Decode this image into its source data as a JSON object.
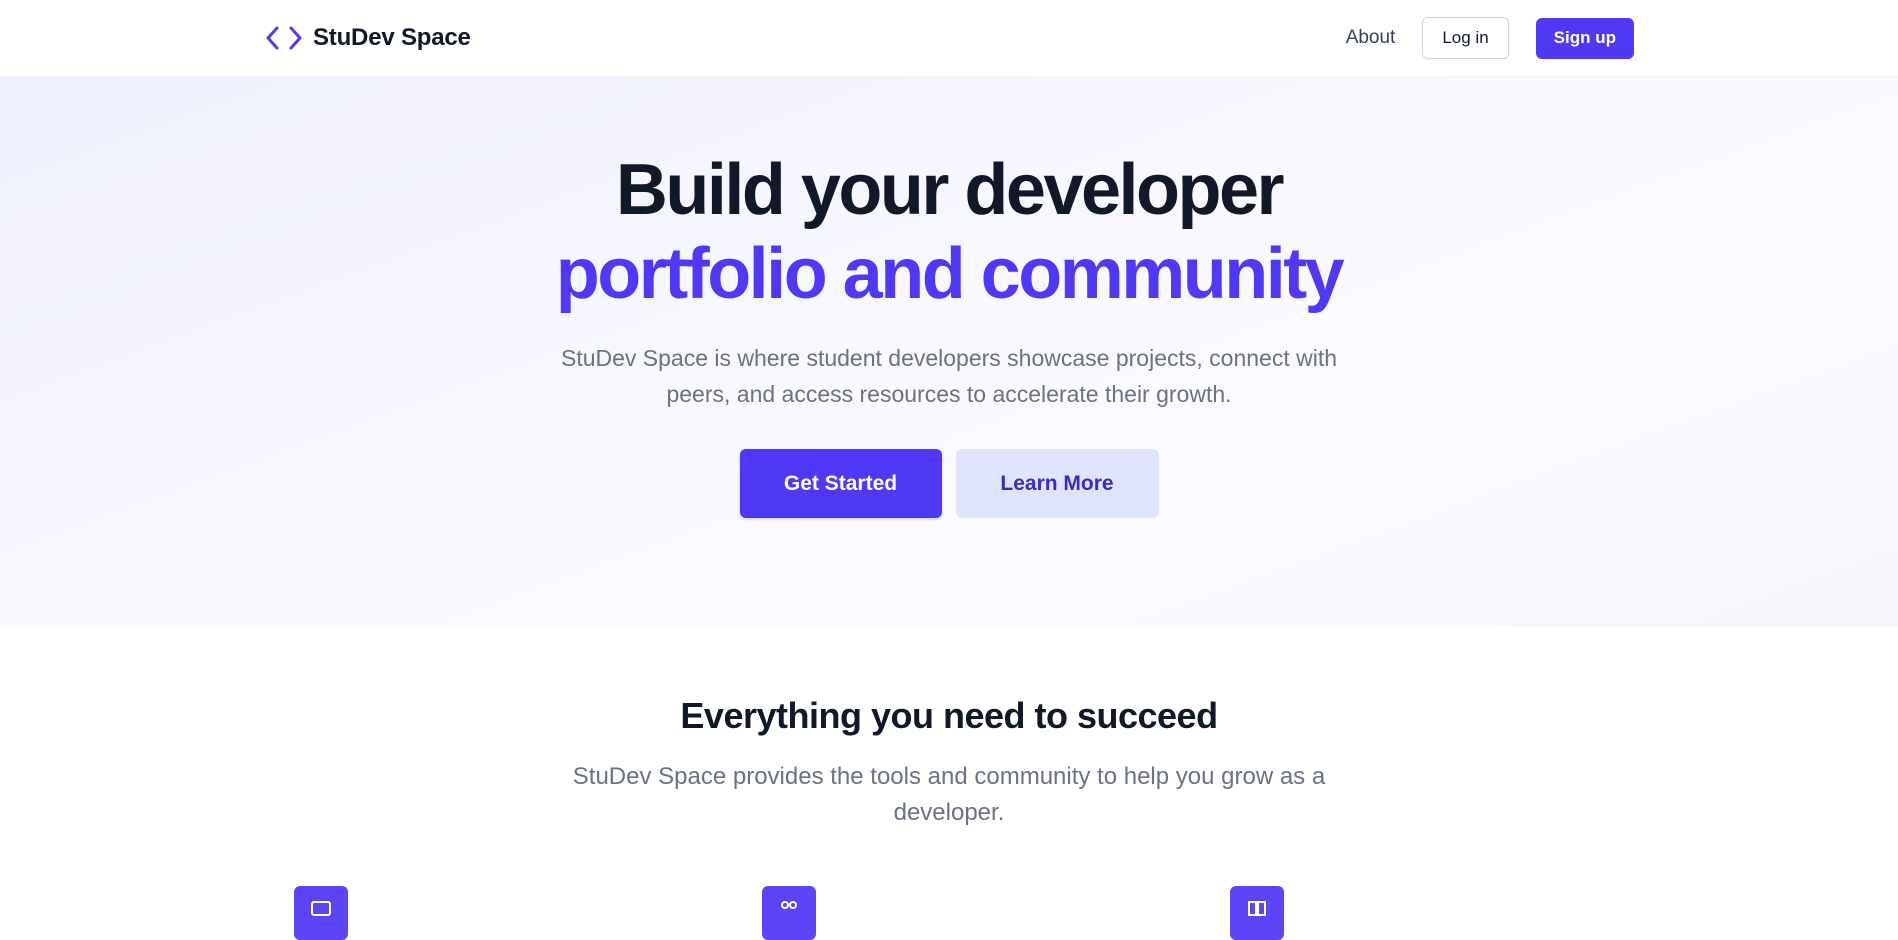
{
  "nav": {
    "brand_name": "StuDev Space",
    "brand_icon": "code-brackets-icon",
    "about_label": "About",
    "login_label": "Log in",
    "signup_label": "Sign up"
  },
  "hero": {
    "title_line1": "Build your developer",
    "title_line2": "portfolio and community",
    "subtitle": "StuDev Space is where student developers showcase projects, connect with peers, and access resources to accelerate their growth.",
    "primary_cta": "Get Started",
    "secondary_cta": "Learn More"
  },
  "features": {
    "title": "Everything you need to succeed",
    "subtitle": "StuDev Space provides the tools and community to help you grow as a developer.",
    "items": [
      {
        "icon": "portfolio-icon"
      },
      {
        "icon": "community-icon"
      },
      {
        "icon": "resources-icon"
      }
    ]
  },
  "colors": {
    "accent": "#4f39f6",
    "heading": "#111827",
    "muted": "#6b7280",
    "secondary_button_bg": "#e0e4fc"
  }
}
